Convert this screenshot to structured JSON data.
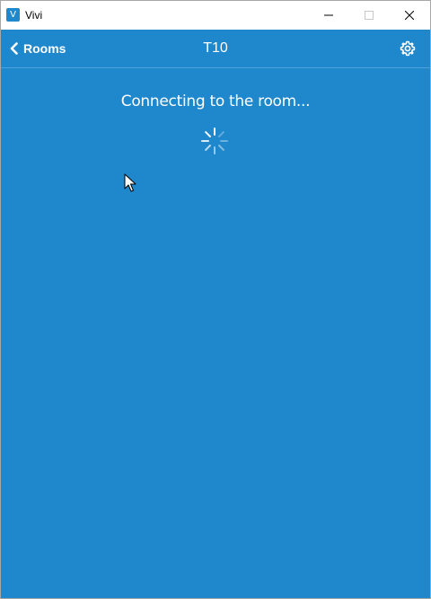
{
  "window": {
    "app_icon_letter": "V",
    "title": "Vivi",
    "icons": [
      "minimize-icon",
      "maximize-icon",
      "close-icon"
    ]
  },
  "navbar": {
    "back_label": "Rooms",
    "room_title": "T10",
    "icons": [
      "chevron-left-icon",
      "gear-icon"
    ]
  },
  "main": {
    "status_text": "Connecting to the room...",
    "icons": [
      "spinner-icon"
    ]
  },
  "colors": {
    "accent": "#1f87cc",
    "text": "#ffffff"
  }
}
